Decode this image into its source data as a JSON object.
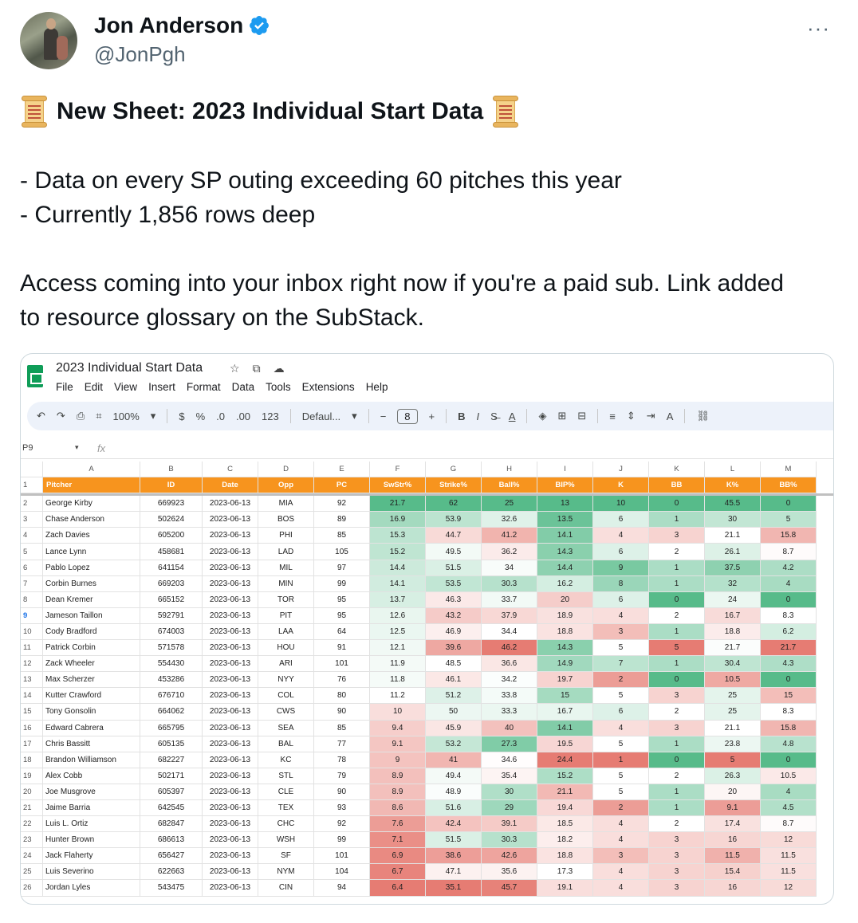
{
  "tweet": {
    "display_name": "Jon Anderson",
    "handle": "@JonPgh",
    "more_label": "···",
    "title": "New Sheet: 2023 Individual Start Data",
    "bullet1": "- Data on every SP outing exceeding 60 pitches this year",
    "bullet2": "- Currently 1,856 rows deep",
    "para1": "Access coming into your inbox right now if you're a paid sub. Link added",
    "para2": "to resource glossary on the SubStack."
  },
  "sheet": {
    "doc_title": "2023 Individual Start Data",
    "menu": [
      "File",
      "Edit",
      "View",
      "Insert",
      "Format",
      "Data",
      "Tools",
      "Extensions",
      "Help"
    ],
    "toolbar": {
      "zoom": "100%",
      "currency": "$",
      "percent": "%",
      "dec_less": ".0",
      "dec_more": ".00",
      "number_fmt": "123",
      "font": "Defaul...",
      "font_size": "8",
      "bold": "B",
      "italic": "I"
    },
    "name_box": "P9",
    "fx": "fx",
    "col_letters": [
      "A",
      "B",
      "C",
      "D",
      "E",
      "F",
      "G",
      "H",
      "I",
      "J",
      "K",
      "L",
      "M"
    ],
    "headers": [
      "Pitcher",
      "ID",
      "Date",
      "Opp",
      "PC",
      "SwStr%",
      "Strike%",
      "Ball%",
      "BIP%",
      "K",
      "BB",
      "K%",
      "BB%"
    ],
    "rows": [
      [
        "George Kirby",
        "669923",
        "2023-06-13",
        "MIA",
        "92",
        "21.7",
        "62",
        "25",
        "13",
        "10",
        "0",
        "45.5",
        "0"
      ],
      [
        "Chase Anderson",
        "502624",
        "2023-06-13",
        "BOS",
        "89",
        "16.9",
        "53.9",
        "32.6",
        "13.5",
        "6",
        "1",
        "30",
        "5"
      ],
      [
        "Zach Davies",
        "605200",
        "2023-06-13",
        "PHI",
        "85",
        "15.3",
        "44.7",
        "41.2",
        "14.1",
        "4",
        "3",
        "21.1",
        "15.8"
      ],
      [
        "Lance Lynn",
        "458681",
        "2023-06-13",
        "LAD",
        "105",
        "15.2",
        "49.5",
        "36.2",
        "14.3",
        "6",
        "2",
        "26.1",
        "8.7"
      ],
      [
        "Pablo Lopez",
        "641154",
        "2023-06-13",
        "MIL",
        "97",
        "14.4",
        "51.5",
        "34",
        "14.4",
        "9",
        "1",
        "37.5",
        "4.2"
      ],
      [
        "Corbin Burnes",
        "669203",
        "2023-06-13",
        "MIN",
        "99",
        "14.1",
        "53.5",
        "30.3",
        "16.2",
        "8",
        "1",
        "32",
        "4"
      ],
      [
        "Dean Kremer",
        "665152",
        "2023-06-13",
        "TOR",
        "95",
        "13.7",
        "46.3",
        "33.7",
        "20",
        "6",
        "0",
        "24",
        "0"
      ],
      [
        "Jameson Taillon",
        "592791",
        "2023-06-13",
        "PIT",
        "95",
        "12.6",
        "43.2",
        "37.9",
        "18.9",
        "4",
        "2",
        "16.7",
        "8.3"
      ],
      [
        "Cody Bradford",
        "674003",
        "2023-06-13",
        "LAA",
        "64",
        "12.5",
        "46.9",
        "34.4",
        "18.8",
        "3",
        "1",
        "18.8",
        "6.2"
      ],
      [
        "Patrick Corbin",
        "571578",
        "2023-06-13",
        "HOU",
        "91",
        "12.1",
        "39.6",
        "46.2",
        "14.3",
        "5",
        "5",
        "21.7",
        "21.7"
      ],
      [
        "Zack Wheeler",
        "554430",
        "2023-06-13",
        "ARI",
        "101",
        "11.9",
        "48.5",
        "36.6",
        "14.9",
        "7",
        "1",
        "30.4",
        "4.3"
      ],
      [
        "Max Scherzer",
        "453286",
        "2023-06-13",
        "NYY",
        "76",
        "11.8",
        "46.1",
        "34.2",
        "19.7",
        "2",
        "0",
        "10.5",
        "0"
      ],
      [
        "Kutter Crawford",
        "676710",
        "2023-06-13",
        "COL",
        "80",
        "11.2",
        "51.2",
        "33.8",
        "15",
        "5",
        "3",
        "25",
        "15"
      ],
      [
        "Tony Gonsolin",
        "664062",
        "2023-06-13",
        "CWS",
        "90",
        "10",
        "50",
        "33.3",
        "16.7",
        "6",
        "2",
        "25",
        "8.3"
      ],
      [
        "Edward Cabrera",
        "665795",
        "2023-06-13",
        "SEA",
        "85",
        "9.4",
        "45.9",
        "40",
        "14.1",
        "4",
        "3",
        "21.1",
        "15.8"
      ],
      [
        "Chris Bassitt",
        "605135",
        "2023-06-13",
        "BAL",
        "77",
        "9.1",
        "53.2",
        "27.3",
        "19.5",
        "5",
        "1",
        "23.8",
        "4.8"
      ],
      [
        "Brandon Williamson",
        "682227",
        "2023-06-13",
        "KC",
        "78",
        "9",
        "41",
        "34.6",
        "24.4",
        "1",
        "0",
        "5",
        "0"
      ],
      [
        "Alex Cobb",
        "502171",
        "2023-06-13",
        "STL",
        "79",
        "8.9",
        "49.4",
        "35.4",
        "15.2",
        "5",
        "2",
        "26.3",
        "10.5"
      ],
      [
        "Joe Musgrove",
        "605397",
        "2023-06-13",
        "CLE",
        "90",
        "8.9",
        "48.9",
        "30",
        "21.1",
        "5",
        "1",
        "20",
        "4"
      ],
      [
        "Jaime Barria",
        "642545",
        "2023-06-13",
        "TEX",
        "93",
        "8.6",
        "51.6",
        "29",
        "19.4",
        "2",
        "1",
        "9.1",
        "4.5"
      ],
      [
        "Luis L. Ortiz",
        "682847",
        "2023-06-13",
        "CHC",
        "92",
        "7.6",
        "42.4",
        "39.1",
        "18.5",
        "4",
        "2",
        "17.4",
        "8.7"
      ],
      [
        "Hunter Brown",
        "686613",
        "2023-06-13",
        "WSH",
        "99",
        "7.1",
        "51.5",
        "30.3",
        "18.2",
        "4",
        "3",
        "16",
        "12"
      ],
      [
        "Jack Flaherty",
        "656427",
        "2023-06-13",
        "SF",
        "101",
        "6.9",
        "38.6",
        "42.6",
        "18.8",
        "3",
        "3",
        "11.5",
        "11.5"
      ],
      [
        "Luis Severino",
        "622663",
        "2023-06-13",
        "NYM",
        "104",
        "6.7",
        "47.1",
        "35.6",
        "17.3",
        "4",
        "3",
        "15.4",
        "11.5"
      ],
      [
        "Jordan Lyles",
        "543475",
        "2023-06-13",
        "CIN",
        "94",
        "6.4",
        "35.1",
        "45.7",
        "19.1",
        "4",
        "3",
        "16",
        "12"
      ]
    ],
    "colors": {
      "header_orange": "#f7941e",
      "good_strong": "#57bb8a",
      "bad_strong": "#e67c73"
    }
  }
}
